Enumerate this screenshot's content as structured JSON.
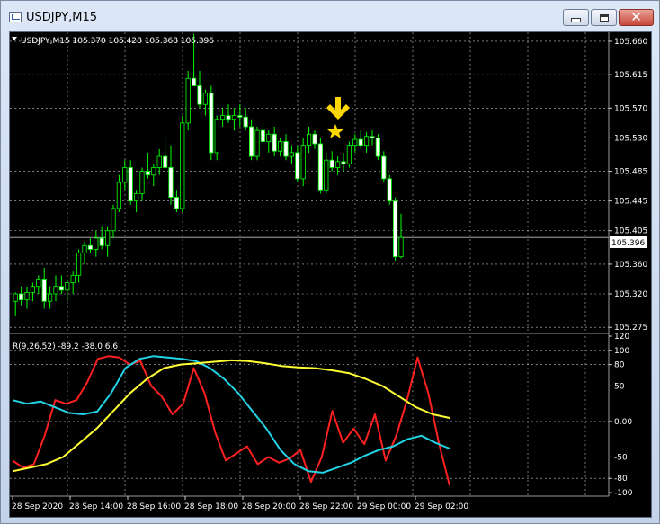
{
  "window": {
    "title": "USDJPY,M15",
    "buttons": {
      "minimize": "minimize-icon",
      "maximize": "maximize-icon",
      "close": "close-icon"
    }
  },
  "chart": {
    "header": "USDJPY,M15  105.370 105.428 105.368 105.396",
    "current_price": "105.396",
    "price_labels": [
      "105.660",
      "105.615",
      "105.570",
      "105.530",
      "105.485",
      "105.445",
      "105.405",
      "105.360",
      "105.320",
      "105.275"
    ],
    "time_labels": [
      "28 Sep 2020",
      "28 Sep 14:00",
      "28 Sep 16:00",
      "28 Sep 18:00",
      "28 Sep 20:00",
      "28 Sep 22:00",
      "29 Sep 00:00",
      "29 Sep 02:00"
    ],
    "colors": {
      "background": "#000000",
      "grid": "#c0c0c0",
      "candle": "#00ff00",
      "arrow": "#ffd700",
      "red_line": "#ff2020",
      "cyan_line": "#22d3e6",
      "yellow_line": "#ffff33"
    },
    "markers": [
      "star-icon",
      "arrow-down-icon"
    ]
  },
  "indicator": {
    "header": "R(9,26,52) -89.2 -38.0 6.6",
    "scale_labels": [
      "120",
      "100",
      "80",
      "50",
      "0.00",
      "-50",
      "-80",
      "-100"
    ]
  },
  "chart_data": [
    {
      "type": "candlestick",
      "title": "USDJPY,M15",
      "ylim": [
        105.268,
        105.672
      ],
      "series": [
        {
          "name": "USDJPY",
          "ohlc": [
            [
              105.31,
              105.322,
              105.29,
              105.32
            ],
            [
              105.32,
              105.33,
              105.305,
              105.312
            ],
            [
              105.312,
              105.33,
              105.3,
              105.322
            ],
            [
              105.322,
              105.335,
              105.31,
              105.33
            ],
            [
              105.33,
              105.345,
              105.32,
              105.34
            ],
            [
              105.34,
              105.355,
              105.3,
              105.31
            ],
            [
              105.31,
              105.33,
              105.3,
              105.32
            ],
            [
              105.32,
              105.345,
              105.31,
              105.33
            ],
            [
              105.33,
              105.345,
              105.32,
              105.325
            ],
            [
              105.325,
              105.34,
              105.31,
              105.335
            ],
            [
              105.335,
              105.35,
              105.32,
              105.345
            ],
            [
              105.345,
              105.38,
              105.335,
              105.375
            ],
            [
              105.375,
              105.39,
              105.36,
              105.385
            ],
            [
              105.385,
              105.395,
              105.375,
              105.38
            ],
            [
              105.38,
              105.405,
              105.37,
              105.395
            ],
            [
              105.395,
              105.41,
              105.38,
              105.385
            ],
            [
              105.385,
              105.41,
              105.37,
              105.405
            ],
            [
              105.405,
              105.44,
              105.395,
              105.435
            ],
            [
              105.435,
              105.48,
              105.43,
              105.47
            ],
            [
              105.47,
              105.5,
              105.46,
              105.49
            ],
            [
              105.49,
              105.5,
              105.44,
              105.445
            ],
            [
              105.445,
              105.46,
              105.43,
              105.455
            ],
            [
              105.455,
              105.49,
              105.445,
              105.485
            ],
            [
              105.485,
              105.51,
              105.475,
              105.48
            ],
            [
              105.48,
              105.495,
              105.465,
              105.49
            ],
            [
              105.49,
              105.515,
              105.48,
              105.505
            ],
            [
              105.505,
              105.53,
              105.495,
              105.49
            ],
            [
              105.49,
              105.52,
              105.44,
              105.45
            ],
            [
              105.45,
              105.46,
              105.43,
              105.435
            ],
            [
              105.435,
              105.56,
              105.43,
              105.55
            ],
            [
              105.55,
              105.62,
              105.54,
              105.61
            ],
            [
              105.61,
              105.67,
              105.6,
              105.6
            ],
            [
              105.6,
              105.62,
              105.57,
              105.575
            ],
            [
              105.575,
              105.595,
              105.56,
              105.59
            ],
            [
              105.59,
              105.6,
              105.5,
              105.51
            ],
            [
              105.51,
              105.56,
              105.5,
              105.555
            ],
            [
              105.555,
              105.57,
              105.545,
              105.56
            ],
            [
              105.56,
              105.575,
              105.55,
              105.555
            ],
            [
              105.555,
              105.57,
              105.54,
              105.56
            ],
            [
              105.56,
              105.575,
              105.545,
              105.558
            ],
            [
              105.558,
              105.57,
              105.54,
              105.545
            ],
            [
              105.545,
              105.555,
              105.5,
              105.505
            ],
            [
              105.505,
              105.545,
              105.5,
              105.54
            ],
            [
              105.54,
              105.55,
              105.52,
              105.525
            ],
            [
              105.525,
              105.54,
              105.51,
              105.535
            ],
            [
              105.535,
              105.545,
              105.505,
              105.512
            ],
            [
              105.512,
              105.53,
              105.505,
              105.525
            ],
            [
              105.525,
              105.535,
              105.5,
              105.505
            ],
            [
              105.505,
              105.52,
              105.495,
              105.51
            ],
            [
              105.51,
              105.52,
              105.47,
              105.475
            ],
            [
              105.475,
              105.53,
              105.465,
              105.52
            ],
            [
              105.52,
              105.545,
              105.51,
              105.535
            ],
            [
              105.535,
              105.54,
              105.515,
              105.522
            ],
            [
              105.522,
              105.53,
              105.455,
              105.46
            ],
            [
              105.46,
              105.51,
              105.455,
              105.5
            ],
            [
              105.5,
              105.512,
              105.485,
              105.49
            ],
            [
              105.49,
              105.505,
              105.48,
              105.498
            ],
            [
              105.498,
              105.51,
              105.485,
              105.495
            ],
            [
              105.495,
              105.525,
              105.49,
              105.52
            ],
            [
              105.52,
              105.535,
              105.51,
              105.528
            ],
            [
              105.528,
              105.54,
              105.515,
              105.52
            ],
            [
              105.52,
              105.538,
              105.51,
              105.532
            ],
            [
              105.532,
              105.54,
              105.52,
              105.53
            ],
            [
              105.53,
              105.535,
              105.5,
              105.505
            ],
            [
              105.505,
              105.512,
              105.47,
              105.475
            ],
            [
              105.475,
              105.48,
              105.44,
              105.445
            ],
            [
              105.445,
              105.45,
              105.365,
              105.37
            ],
            [
              105.37,
              105.428,
              105.368,
              105.396
            ]
          ]
        }
      ]
    },
    {
      "type": "line",
      "title": "R(9,26,52) -89.2 -38.0 6.6",
      "ylim": [
        -105,
        120
      ],
      "series": [
        {
          "name": "",
          "values": [
            -55,
            -65,
            -60,
            -20,
            30,
            25,
            30,
            55,
            88,
            92,
            90,
            80,
            85,
            50,
            35,
            10,
            25,
            75,
            40,
            -15,
            -55,
            -45,
            -35,
            -60,
            -50,
            -58,
            -52,
            -40,
            -85,
            -50,
            15,
            -30,
            -10,
            -32,
            10,
            -55,
            -20,
            30,
            90,
            40,
            -30,
            -90
          ]
        },
        {
          "name": "",
          "values": [
            30,
            25,
            28,
            20,
            12,
            10,
            14,
            40,
            75,
            88,
            92,
            90,
            88,
            85,
            75,
            60,
            40,
            15,
            -10,
            -40,
            -60,
            -70,
            -72,
            -65,
            -58,
            -48,
            -40,
            -35,
            -25,
            -20,
            -30,
            -38
          ]
        },
        {
          "name": "",
          "values": [
            -70,
            -65,
            -60,
            -50,
            -30,
            -10,
            15,
            40,
            60,
            75,
            80,
            82,
            84,
            86,
            85,
            82,
            78,
            76,
            75,
            72,
            68,
            60,
            50,
            35,
            20,
            10,
            5
          ]
        }
      ]
    }
  ]
}
